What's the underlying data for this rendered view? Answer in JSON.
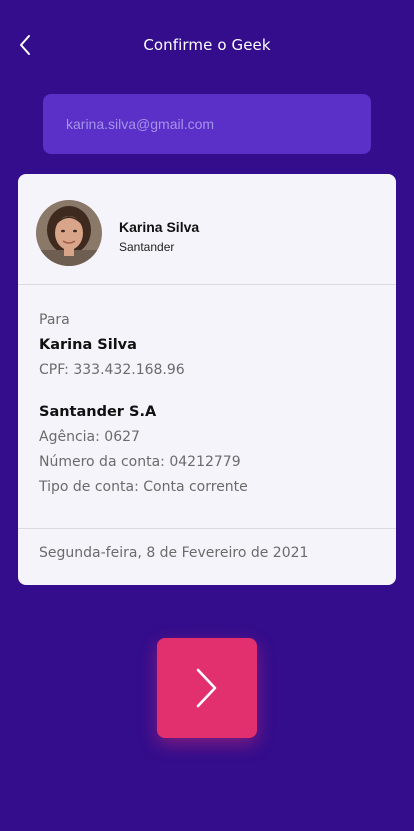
{
  "header": {
    "title": "Confirme o Geek",
    "back_icon": "chevron-left-icon"
  },
  "email": {
    "value": "karina.silva@gmail.com"
  },
  "profile": {
    "name": "Karina Silva",
    "bank": "Santander"
  },
  "recipient": {
    "to_label": "Para",
    "name": "Karina Silva",
    "cpf": "CPF: 333.432.168.96",
    "bank_name": "Santander S.A",
    "agency": "Agência: 0627",
    "account_number": "Número da conta: 04212779",
    "account_type": "Tipo de conta: Conta corrente"
  },
  "date": "Segunda-feira, 8 de Fevereiro de 2021",
  "next_button": {
    "icon": "chevron-right-icon"
  },
  "colors": {
    "background": "#330d8c",
    "input": "#5b30c9",
    "card": "#f6f4fb",
    "accent": "#e2306e"
  }
}
